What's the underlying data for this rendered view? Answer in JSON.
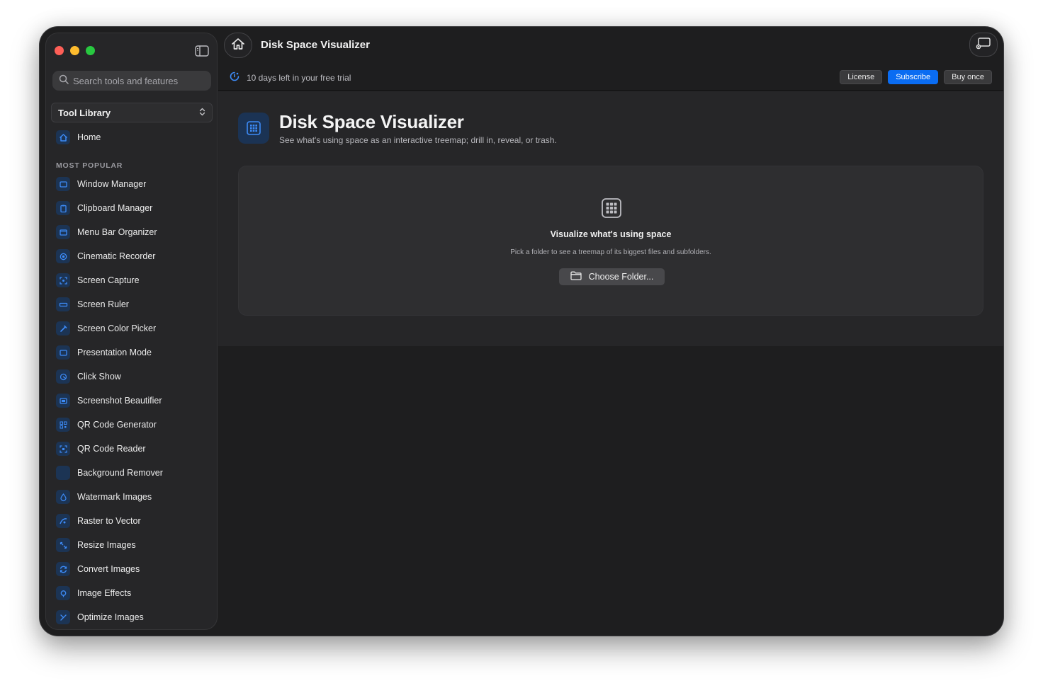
{
  "window": {
    "title": "Disk Space Visualizer"
  },
  "sidebar": {
    "search_placeholder": "Search tools and features",
    "library_select": "Tool Library",
    "home_label": "Home",
    "section_label": "MOST POPULAR",
    "items": [
      {
        "label": "Window Manager",
        "icon": "window-icon"
      },
      {
        "label": "Clipboard Manager",
        "icon": "clipboard-icon"
      },
      {
        "label": "Menu Bar Organizer",
        "icon": "menubar-icon"
      },
      {
        "label": "Cinematic Recorder",
        "icon": "record-icon"
      },
      {
        "label": "Screen Capture",
        "icon": "capture-icon"
      },
      {
        "label": "Screen Ruler",
        "icon": "ruler-icon"
      },
      {
        "label": "Screen Color Picker",
        "icon": "eyedropper-icon"
      },
      {
        "label": "Presentation Mode",
        "icon": "presentation-icon"
      },
      {
        "label": "Click Show",
        "icon": "click-icon"
      },
      {
        "label": "Screenshot Beautifier",
        "icon": "beautify-icon"
      },
      {
        "label": "QR Code Generator",
        "icon": "qr-icon"
      },
      {
        "label": "QR Code Reader",
        "icon": "qr-scan-icon"
      },
      {
        "label": "Background Remover",
        "icon": "background-icon"
      },
      {
        "label": "Watermark Images",
        "icon": "drop-icon"
      },
      {
        "label": "Raster to Vector",
        "icon": "vector-icon"
      },
      {
        "label": "Resize Images",
        "icon": "resize-icon"
      },
      {
        "label": "Convert Images",
        "icon": "convert-icon"
      },
      {
        "label": "Image Effects",
        "icon": "effects-icon"
      },
      {
        "label": "Optimize Images",
        "icon": "optimize-icon"
      }
    ]
  },
  "topbar": {
    "title": "Disk Space Visualizer",
    "trial_text": "10 days left in your free trial",
    "license_label": "License",
    "subscribe_label": "Subscribe",
    "buy_label": "Buy once"
  },
  "page": {
    "title": "Disk Space Visualizer",
    "subtitle": "See what's using space as an interactive treemap; drill in, reveal, or trash.",
    "empty_title": "Visualize what's using space",
    "empty_desc": "Pick a folder to see a treemap of its biggest files and subfolders.",
    "choose_label": "Choose Folder..."
  },
  "colors": {
    "accent": "#0a6cf2",
    "icon_blue": "#3d8bf7",
    "icon_bg": "#1c3454"
  }
}
